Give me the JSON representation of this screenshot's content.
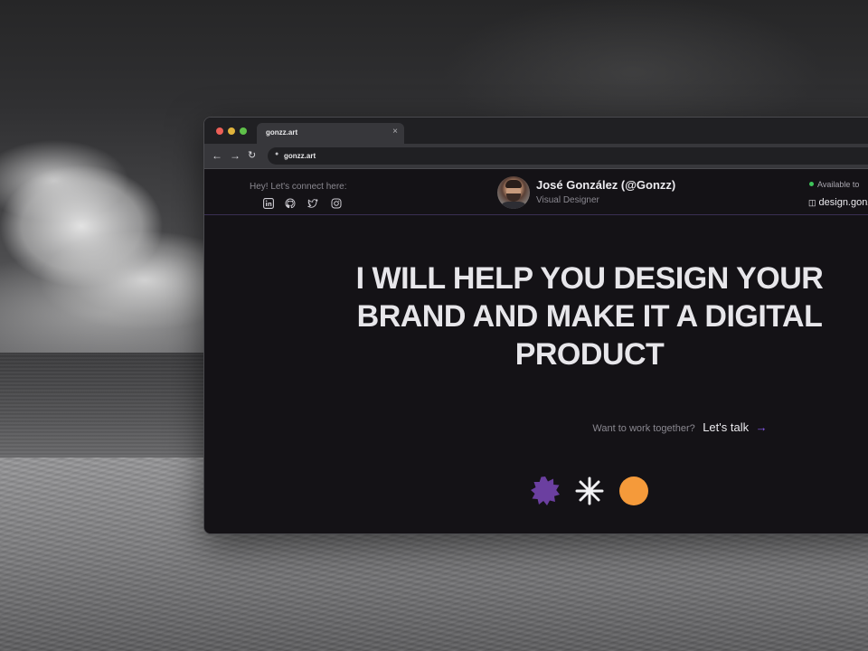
{
  "browser": {
    "tab_title": "gonzz.art",
    "tab_close": "×",
    "url": "gonzz.art"
  },
  "header": {
    "connect_label": "Hey! Let's connect here:",
    "social_icons": [
      "linkedin-icon",
      "github-icon",
      "twitter-icon",
      "instagram-icon"
    ],
    "profile_name": "José González (@Gonzz)",
    "profile_role": "Visual Designer",
    "status_text": "Available to",
    "site_link": "design.gonz"
  },
  "hero": {
    "headline": "I WILL HELP YOU DESIGN YOUR BRAND AND MAKE IT A DIGITAL PRODUCT",
    "cta_question": "Want to work together?",
    "cta_link": "Let's talk",
    "cta_arrow": "→"
  },
  "colors": {
    "page_bg": "#141216",
    "accent_purple": "#6b3fa0",
    "accent_orange": "#f59a3a",
    "status_green": "#3ec45a",
    "arrow_purple": "#8b5cf6"
  },
  "decor_icons": [
    "purple-starburst-icon",
    "white-asterisk-icon",
    "orange-circle-icon"
  ]
}
